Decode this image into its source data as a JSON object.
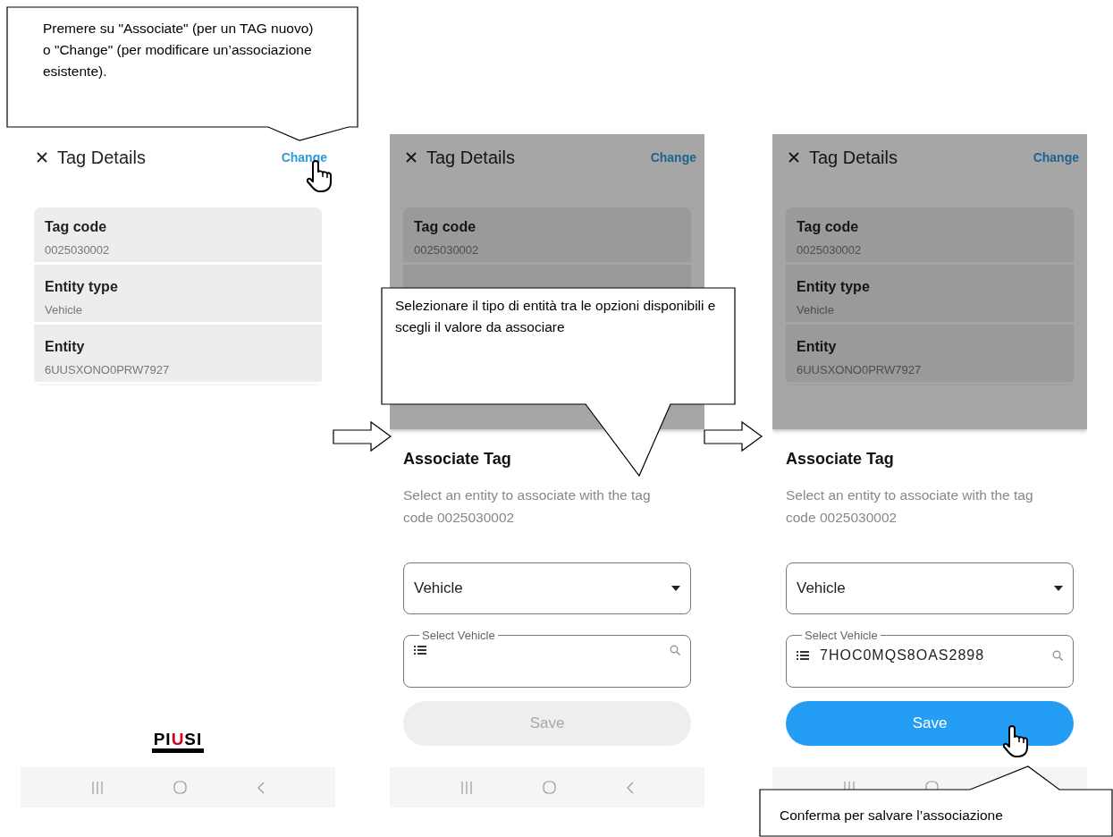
{
  "callouts": [
    {
      "text": "Premere su \"Associate\" (per un TAG nuovo) o \"Change\" (per modificare un’associazione esistente)."
    },
    {
      "text": "Selezionare il tipo di entità tra le opzioni disponibili e scegli il valore da associare"
    },
    {
      "text": "Conferma per salvare l’associazione"
    }
  ],
  "screens": [
    {
      "kind": "details",
      "dimmed": false,
      "title": "Tag Details",
      "action": "Change",
      "action_pointer": true,
      "rows": [
        {
          "label": "Tag code",
          "value": "0025030002"
        },
        {
          "label": "Entity type",
          "value": "Vehicle"
        },
        {
          "label": "Entity",
          "value": "6UUSXONO0PRW7927"
        }
      ],
      "logo": [
        {
          "text": "PI"
        },
        {
          "text": "U",
          "color": "#d0021b"
        },
        {
          "text": "SI"
        }
      ]
    },
    {
      "kind": "associate",
      "dimmed": true,
      "title": "Tag Details",
      "action": "Change",
      "action_pointer": false,
      "rows": [
        {
          "label": "Tag code",
          "value": "0025030002"
        }
      ],
      "sheet": {
        "title": "Associate Tag",
        "text": "Select an entity to associate with the tag code 0025030002",
        "entity_type": "Vehicle",
        "search_label": "Select Vehicle",
        "save": "Save",
        "save_disabled": true,
        "save_pointer": false
      }
    },
    {
      "kind": "associate",
      "dimmed": true,
      "title": "Tag Details",
      "action": "Change",
      "action_pointer": false,
      "rows": [
        {
          "label": "Tag code",
          "value": "0025030002"
        },
        {
          "label": "Entity type",
          "value": "Vehicle"
        },
        {
          "label": "Entity",
          "value": "6UUSXONO0PRW7927"
        }
      ],
      "sheet": {
        "title": "Associate Tag",
        "text": "Select an entity to associate with the tag code 0025030002",
        "entity_type": "Vehicle",
        "search_label": "Select Vehicle",
        "search_value": "7HOC0MQS8OAS2898",
        "save": "Save",
        "save_disabled": false,
        "save_pointer": true
      }
    }
  ]
}
